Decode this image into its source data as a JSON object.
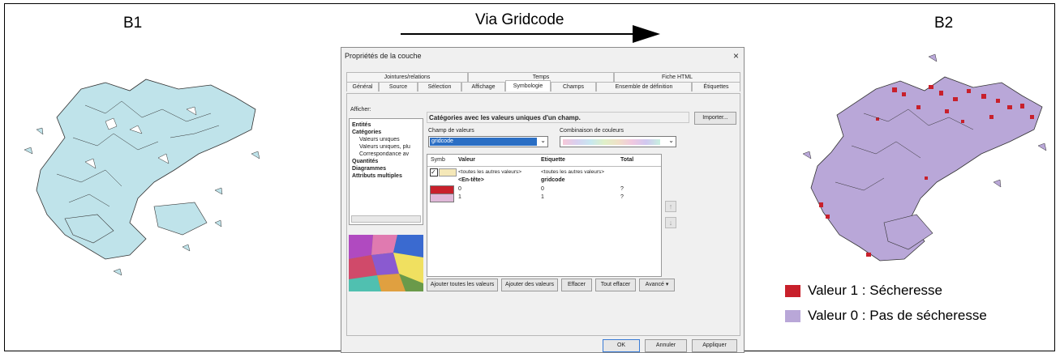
{
  "labels": {
    "b1": "B1",
    "b2": "B2",
    "via": "Via Gridcode"
  },
  "colors": {
    "map_b1": "#bfe3ea",
    "map_b2": "#b9a7d8",
    "red": "#c8202b",
    "purple": "#b9a7d8"
  },
  "dialog": {
    "title": "Propriétés de la couche",
    "close": "×",
    "tabs_top": [
      "Jointures/relations",
      "Temps",
      "Fiche HTML"
    ],
    "tabs_bottom": [
      "Général",
      "Source",
      "Sélection",
      "Affichage",
      "Symbologie",
      "Champs",
      "Ensemble de définition",
      "Étiquettes"
    ],
    "afficher": "Afficher:",
    "tree": [
      "Entités",
      "Catégories",
      "Valeurs uniques",
      "Valeurs uniques, plu",
      "Correspondance av",
      "Quantités",
      "Diagrammes",
      "Attributs multiples"
    ],
    "header": "Catégories avec les valeurs uniques d'un champ.",
    "importer": "Importer...",
    "champ_label": "Champ de valeurs",
    "champ_value": "gridcode",
    "combi_label": "Combinaison de couleurs",
    "table": {
      "headers": [
        "Symb",
        "Valeur",
        "Etiquette",
        "Total"
      ],
      "rows": [
        {
          "valeur": "<toutes les autres valeurs>",
          "etiquette": "<toutes les autres valeurs>",
          "total": ""
        },
        {
          "valeur": "<En-tête>",
          "etiquette": "gridcode",
          "total": ""
        },
        {
          "valeur": "0",
          "etiquette": "0",
          "total": "?"
        },
        {
          "valeur": "1",
          "etiquette": "1",
          "total": "?"
        }
      ]
    },
    "buttons": [
      "Ajouter toutes les valeurs",
      "Ajouter des valeurs",
      "Effacer",
      "Tout effacer",
      "Avancé ▾"
    ],
    "footer": [
      "OK",
      "Annuler",
      "Appliquer"
    ]
  },
  "legend": [
    {
      "text": "Valeur 1 : Sécheresse",
      "color": "#c8202b"
    },
    {
      "text": "Valeur 0 : Pas de sécheresse",
      "color": "#b9a7d8"
    }
  ]
}
